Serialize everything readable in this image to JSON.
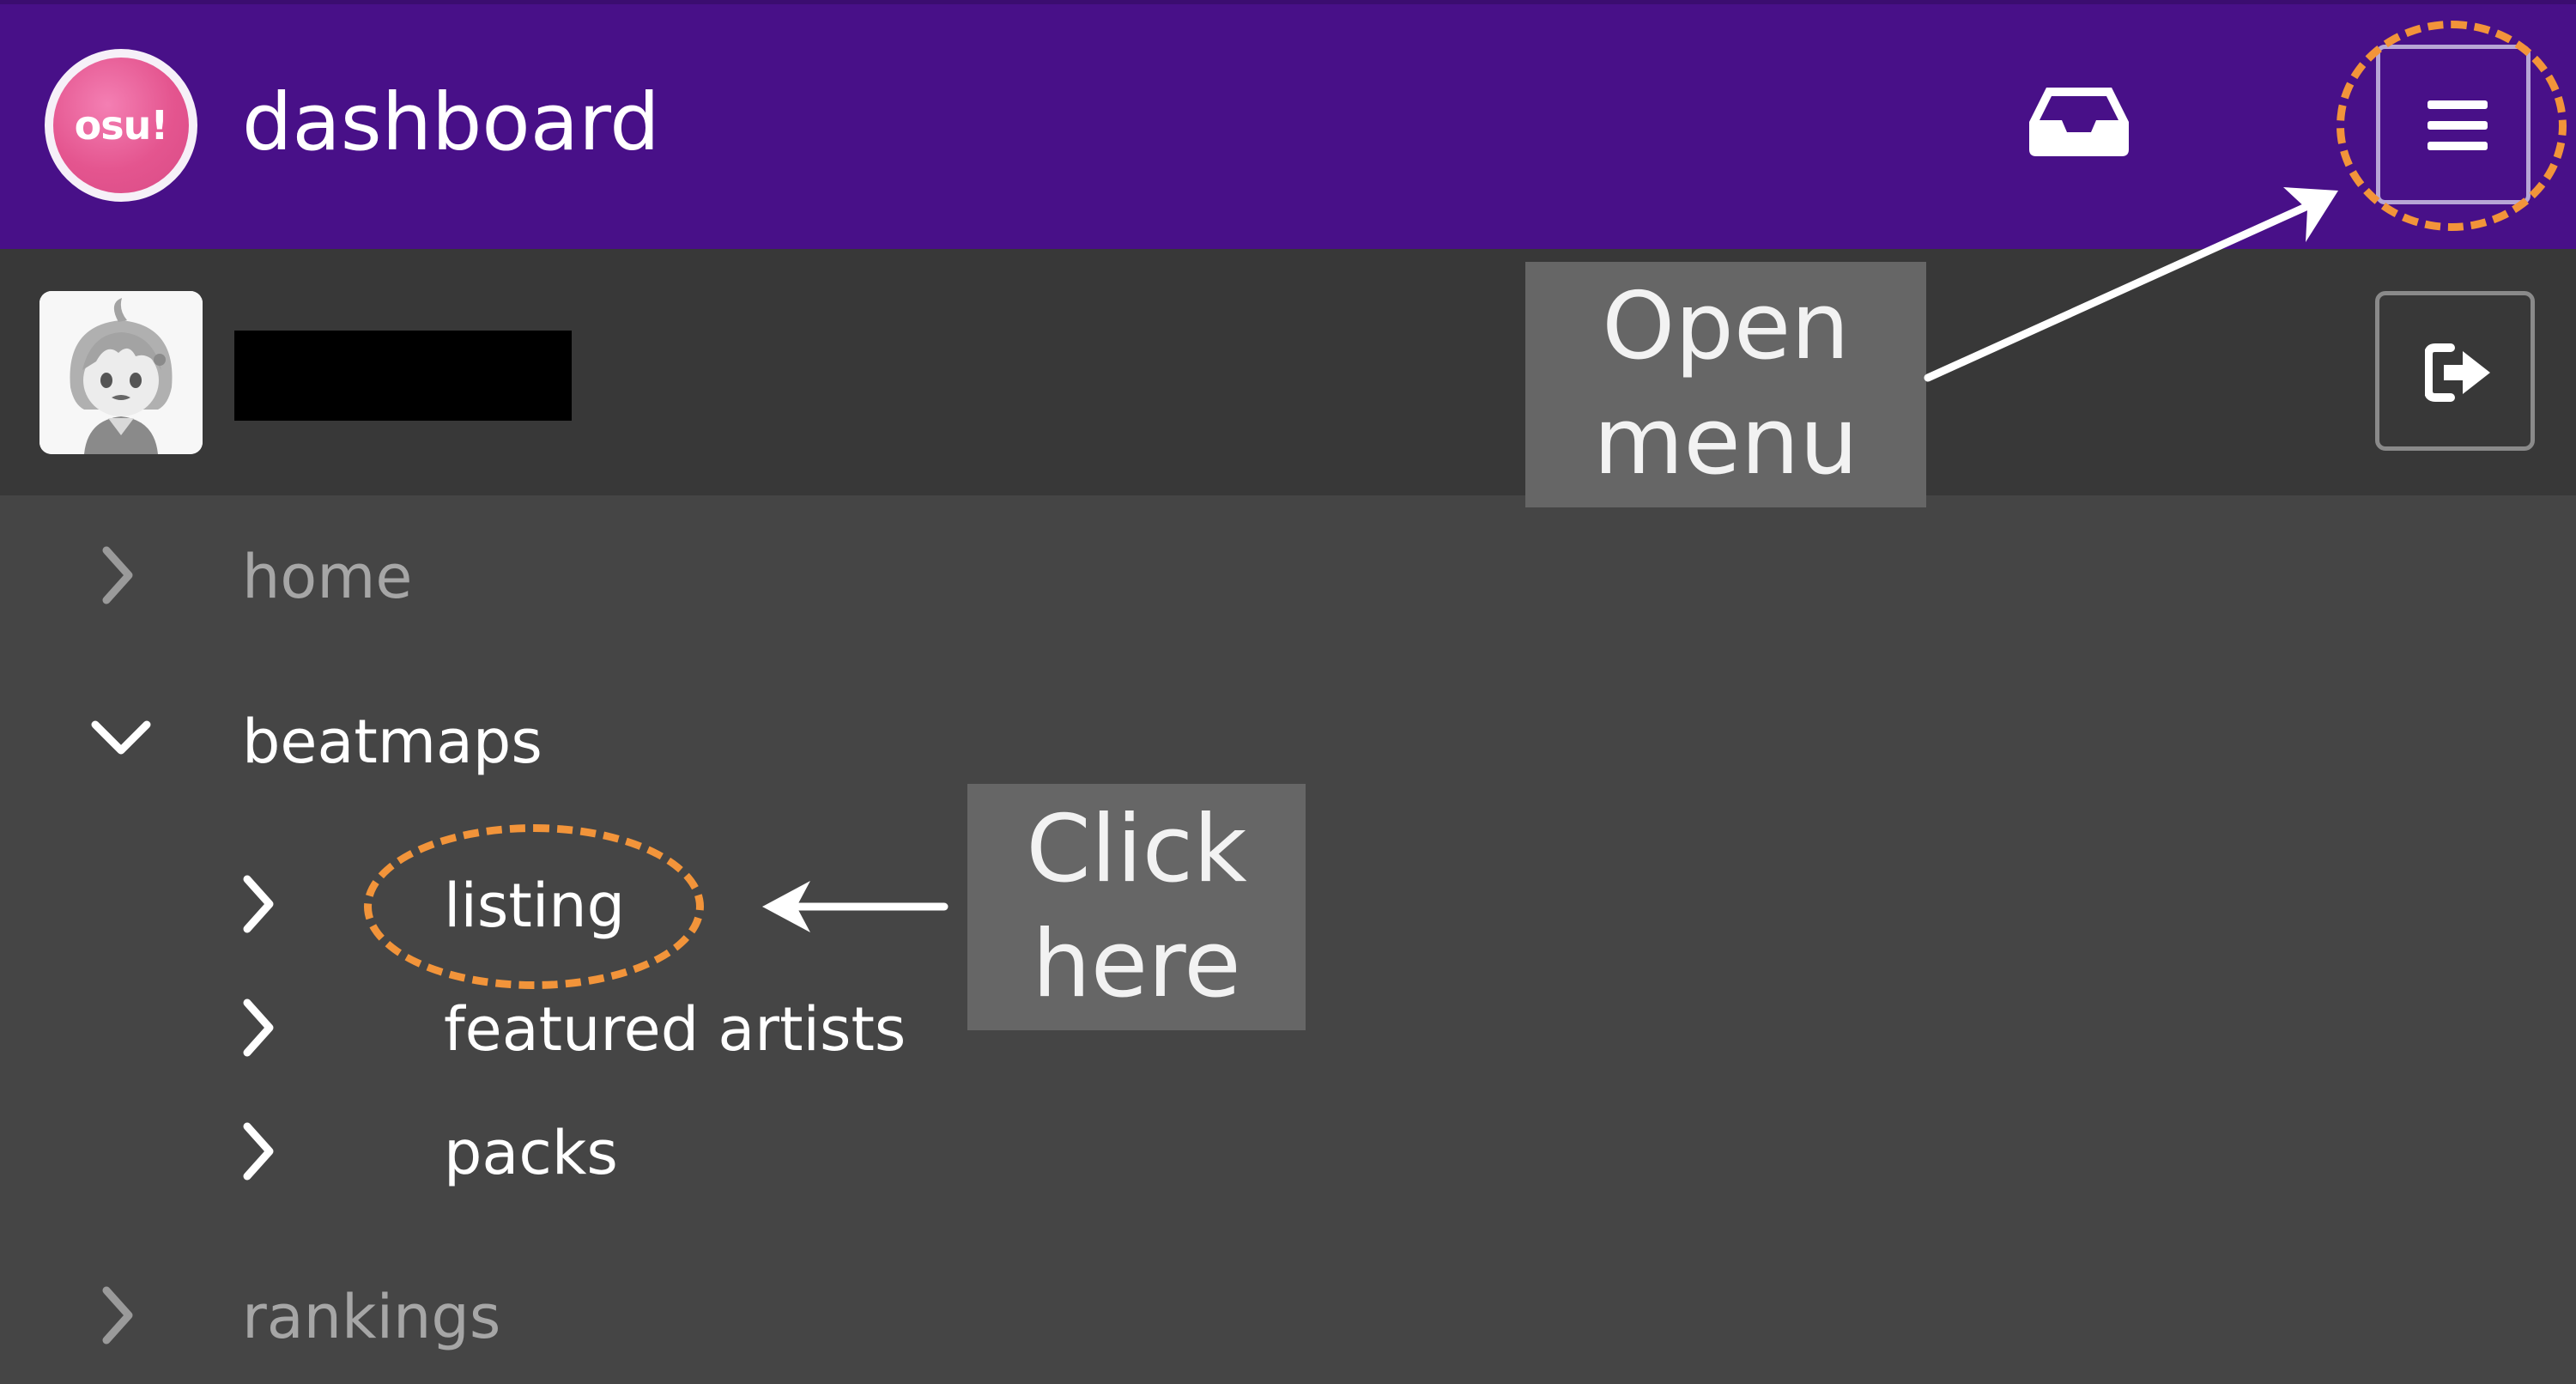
{
  "header": {
    "logo_text": "osu!",
    "title": "dashboard",
    "icons": [
      "inbox-icon",
      "hamburger-menu-icon"
    ],
    "background_color": "#481088"
  },
  "user": {
    "username": "",
    "username_redacted": true,
    "icons": [
      "avatar",
      "sign-out-icon"
    ]
  },
  "nav": {
    "items": [
      {
        "label": "home",
        "expanded": false
      },
      {
        "label": "beatmaps",
        "expanded": true,
        "children": [
          {
            "label": "listing"
          },
          {
            "label": "featured artists"
          },
          {
            "label": "packs"
          }
        ]
      },
      {
        "label": "rankings",
        "expanded": false
      }
    ]
  },
  "annotations": {
    "open_menu": [
      "Open",
      "menu"
    ],
    "click_here": [
      "Click",
      "here"
    ],
    "highlight_color": "#f2943a"
  }
}
